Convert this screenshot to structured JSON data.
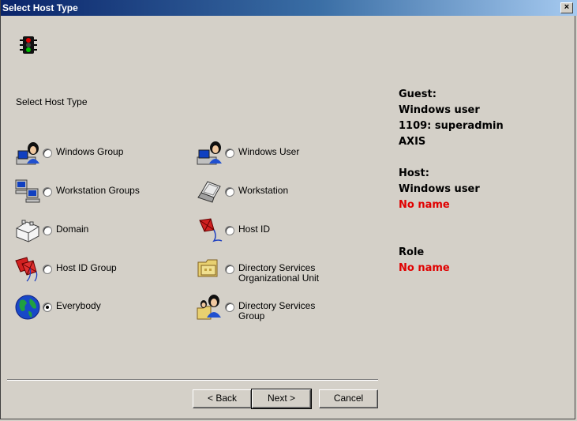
{
  "window": {
    "title": "Select Host Type",
    "close_label": "×"
  },
  "section_label": "Select Host Type",
  "options": [
    {
      "label": "Windows Group",
      "icon": "user-group-icon",
      "checked": false
    },
    {
      "label": "Windows User",
      "icon": "windows-user-icon",
      "checked": false
    },
    {
      "label": "Workstation Groups",
      "icon": "workstation-groups-icon",
      "checked": false
    },
    {
      "label": "Workstation",
      "icon": "laptop-icon",
      "checked": false
    },
    {
      "label": "Domain",
      "icon": "domain-icon",
      "checked": false
    },
    {
      "label": "Host ID",
      "icon": "kite-icon",
      "checked": false
    },
    {
      "label": "Host ID Group",
      "icon": "kite-group-icon",
      "checked": false
    },
    {
      "label": "Directory Services",
      "label2": "Organizational Unit",
      "icon": "folder-icon",
      "checked": false
    },
    {
      "label": "Everybody",
      "icon": "globe-icon",
      "checked": true
    },
    {
      "label": "Directory Services",
      "label2": "Group",
      "icon": "directory-group-icon",
      "checked": false
    }
  ],
  "info": {
    "guest_label": "Guest:",
    "guest_line1": "Windows user",
    "guest_line2": "1109: superadmin",
    "guest_line3": "AXIS",
    "host_label": "Host:",
    "host_line1": "Windows user",
    "host_line2": "No name",
    "role_label": "Role",
    "role_value": "No name"
  },
  "buttons": {
    "back": "< Back",
    "next": "Next >",
    "cancel": "Cancel"
  },
  "colors": {
    "title_start": "#0a246a",
    "title_end": "#a6caf0",
    "warning": "#e00000",
    "face": "#d4d0c8"
  }
}
